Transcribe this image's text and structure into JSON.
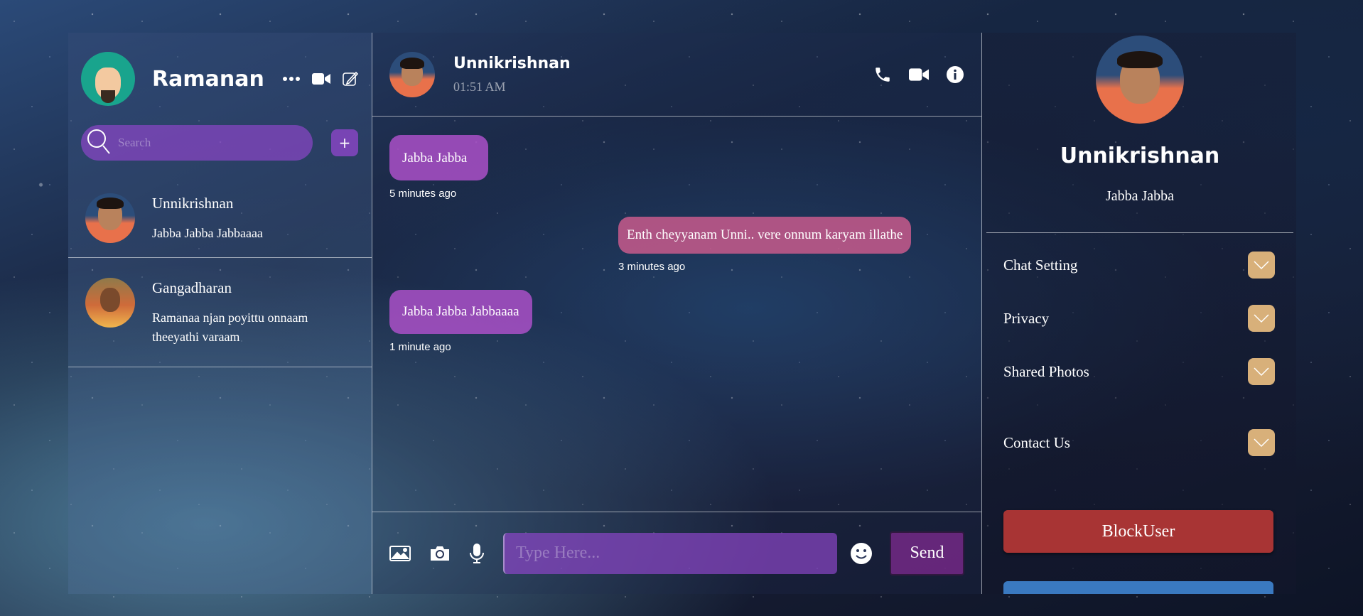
{
  "user": {
    "name": "Ramanan"
  },
  "search": {
    "placeholder": "Search"
  },
  "contacts": [
    {
      "name": "Unnikrishnan",
      "last_message": "Jabba Jabba Jabbaaaa"
    },
    {
      "name": "Gangadharan",
      "last_message": "Ramanaa njan poyittu onnaam theeyathi varaam"
    }
  ],
  "chat": {
    "contact_name": "Unnikrishnan",
    "time": "01:51 AM",
    "messages": [
      {
        "text": "Jabba Jabba",
        "time": "5 minutes ago",
        "direction": "in"
      },
      {
        "text": "Enth cheyyanam Unni.. vere onnum karyam illathe",
        "time": "3 minutes ago",
        "direction": "out"
      },
      {
        "text": "Jabba Jabba Jabbaaaa",
        "time": "1 minute ago",
        "direction": "in"
      }
    ],
    "input_placeholder": "Type Here...",
    "send_label": "Send"
  },
  "profile": {
    "name": "Unnikrishnan",
    "status": "Jabba Jabba",
    "sections": [
      "Chat Setting",
      "Privacy",
      "Shared Photos",
      "Contact Us"
    ],
    "block_label": "BlockUser"
  },
  "colors": {
    "accent_purple": "#8c46c8",
    "outgoing_bubble": "#c85a8c",
    "chevron_button": "#d8b07a",
    "block_button": "#a83434"
  },
  "icons": [
    "more-icon",
    "video-icon",
    "compose-icon",
    "search-icon",
    "plus-icon",
    "phone-icon",
    "info-icon",
    "image-icon",
    "camera-icon",
    "microphone-icon",
    "emoji-icon",
    "chevron-down-icon"
  ]
}
